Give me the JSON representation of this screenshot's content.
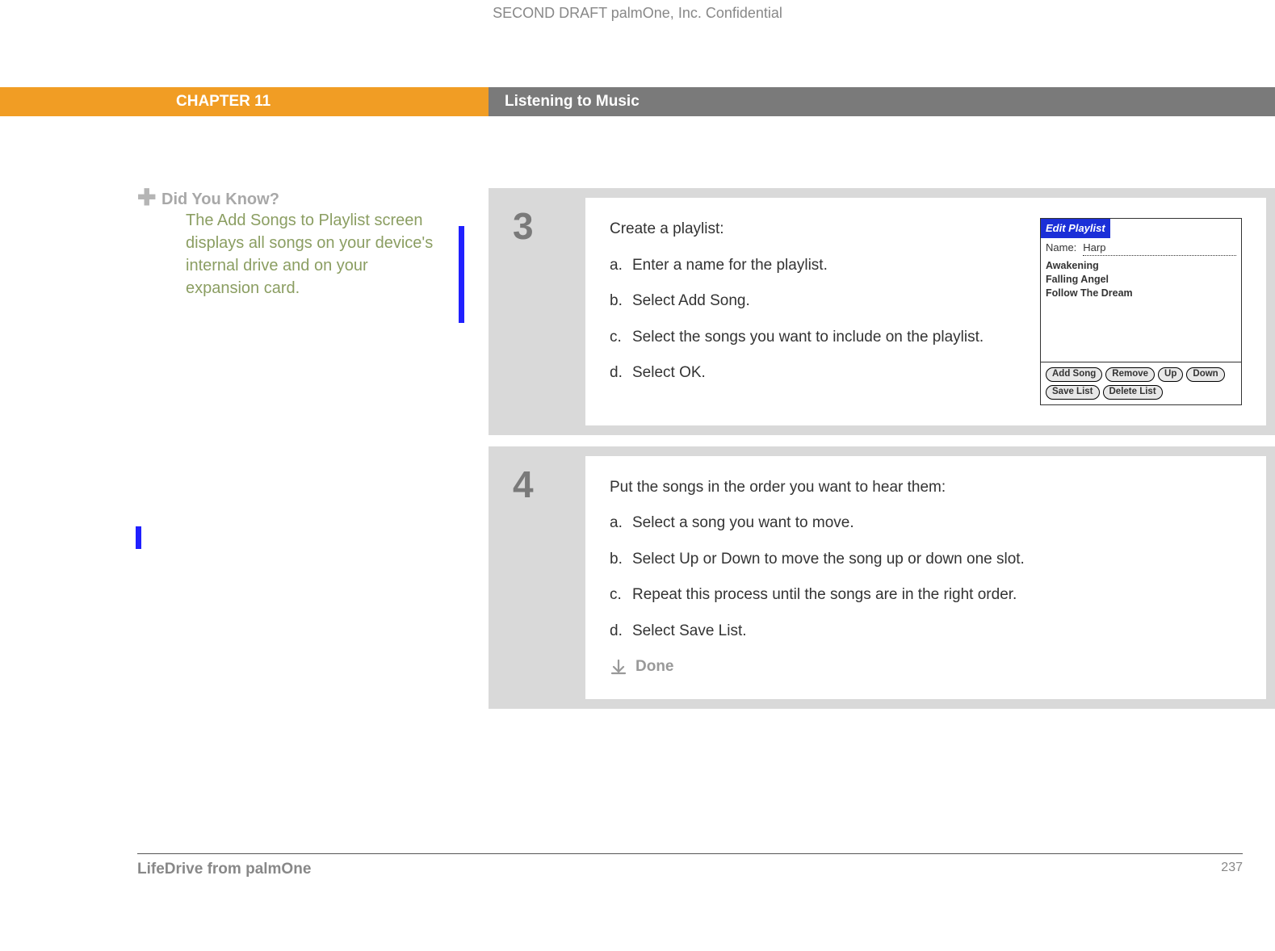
{
  "confidential": "SECOND DRAFT palmOne, Inc.  Confidential",
  "header": {
    "chapter": "CHAPTER 11",
    "section": "Listening to Music"
  },
  "sidebar": {
    "dyk_title": "Did You Know?",
    "dyk_body": "The Add Songs to Playlist screen displays all songs on your device's internal drive and on your expansion card."
  },
  "step3": {
    "num": "3",
    "lead": "Create a playlist:",
    "a": "Enter a name for the playlist.",
    "b": "Select Add Song.",
    "c": "Select the songs you want to include on the playlist.",
    "d": "Select OK."
  },
  "palm": {
    "title": "Edit Playlist",
    "name_label": "Name:",
    "name_value": "Harp",
    "songs": [
      "Awakening",
      "Falling Angel",
      "Follow The Dream"
    ],
    "btn_add": "Add Song",
    "btn_remove": "Remove",
    "btn_up": "Up",
    "btn_down": "Down",
    "btn_save": "Save List",
    "btn_delete": "Delete List"
  },
  "step4": {
    "num": "4",
    "lead": "Put the songs in the order you want to hear them:",
    "a": "Select a song you want to move.",
    "b": "Select Up or Down to move the song up or down one slot.",
    "c": "Repeat this process until the songs are in the right order.",
    "d": "Select Save List.",
    "done": "Done"
  },
  "footer": {
    "product": "LifeDrive from palmOne",
    "page": "237"
  }
}
